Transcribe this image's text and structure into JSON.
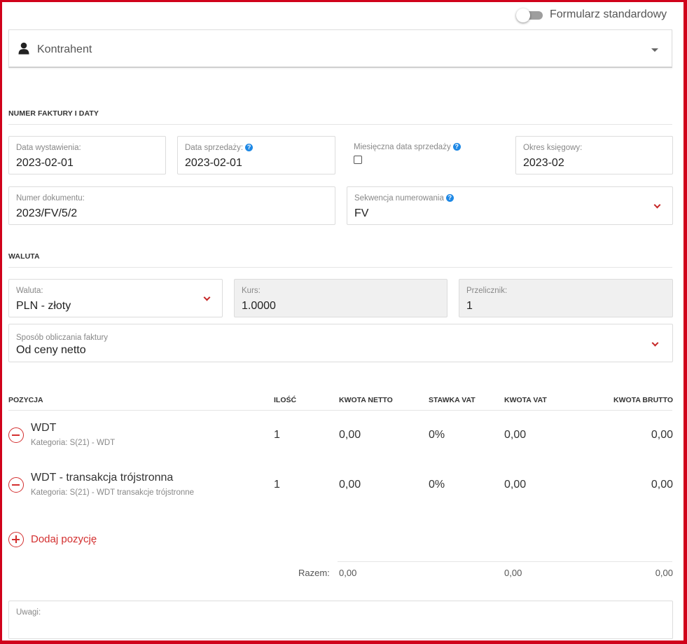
{
  "toggle": {
    "label": "Formularz standardowy",
    "on": false
  },
  "contractor": {
    "label": "Kontrahent",
    "icon": "person-icon"
  },
  "section_dates": {
    "title": "NUMER FAKTURY I DATY"
  },
  "fields": {
    "issue_date": {
      "label": "Data wystawienia:",
      "value": "2023-02-01"
    },
    "sale_date": {
      "label": "Data sprzedaży:",
      "value": "2023-02-01"
    },
    "monthly_sale_date": {
      "label": "Miesięczna data sprzedaży",
      "checked": false
    },
    "accounting_period": {
      "label": "Okres księgowy:",
      "value": "2023-02"
    },
    "doc_number": {
      "label": "Numer dokumentu:",
      "value": "2023/FV/5/2"
    },
    "sequence": {
      "label": "Sekwencja numerowania",
      "value": "FV"
    }
  },
  "section_currency": {
    "title": "WALUTA"
  },
  "currency": {
    "currency": {
      "label": "Waluta:",
      "value": "PLN - złoty"
    },
    "rate": {
      "label": "Kurs:",
      "value": "1.0000"
    },
    "converter": {
      "label": "Przelicznik:",
      "value": "1"
    },
    "calc_method": {
      "label": "Sposób obliczania faktury",
      "value": "Od ceny netto"
    }
  },
  "table": {
    "headers": {
      "position": "POZYCJA",
      "quantity": "ILOŚĆ",
      "net": "KWOTA NETTO",
      "vat_rate": "STAWKA VAT",
      "vat": "KWOTA VAT",
      "gross": "KWOTA BRUTTO"
    },
    "rows": [
      {
        "name": "WDT",
        "category": "Kategoria: S(21) - WDT",
        "quantity": "1",
        "net": "0,00",
        "vat_rate": "0%",
        "vat": "0,00",
        "gross": "0,00"
      },
      {
        "name": "WDT - transakcja trójstronna",
        "category": "Kategoria: S(21) - WDT transakcje trójstronne",
        "quantity": "1",
        "net": "0,00",
        "vat_rate": "0%",
        "vat": "0,00",
        "gross": "0,00"
      }
    ],
    "add_label": "Dodaj pozycję",
    "totals": {
      "label": "Razem:",
      "net": "0,00",
      "vat": "0,00",
      "gross": "0,00"
    }
  },
  "notes": {
    "label": "Uwagi:"
  },
  "colors": {
    "accent": "#d32f2f",
    "help": "#1e88e5",
    "frame": "#d0021b"
  }
}
